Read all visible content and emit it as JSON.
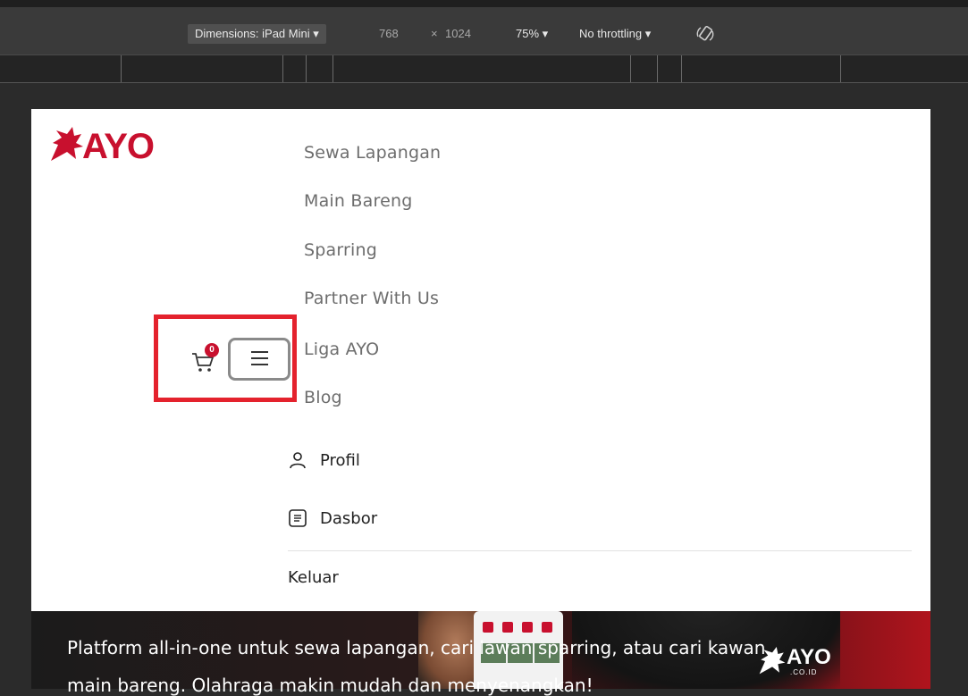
{
  "devtools": {
    "device_label": "Dimensions: iPad Mini ▾",
    "width": "768",
    "x_sep": "×",
    "height": "1024",
    "zoom": "75% ▾",
    "throttling": "No throttling ▾"
  },
  "brand": {
    "logo_text": "AYO",
    "accent_color": "#c8102e"
  },
  "nav": {
    "items": [
      {
        "label": "Sewa Lapangan"
      },
      {
        "label": "Main Bareng"
      },
      {
        "label": "Sparring"
      },
      {
        "label": "Partner With Us"
      },
      {
        "label": "Liga AYO"
      },
      {
        "label": "Blog"
      }
    ]
  },
  "account": {
    "profile_label": "Profil",
    "dashboard_label": "Dasbor",
    "logout_label": "Keluar"
  },
  "cart": {
    "count": "0"
  },
  "hero": {
    "line1": "Platform all-in-one untuk sewa lapangan, cari lawan sparring, atau cari kawan",
    "line2": "main bareng. Olahraga makin mudah dan menyenangkan!",
    "logo_text": "AYO",
    "logo_sub": ".CO.ID"
  }
}
